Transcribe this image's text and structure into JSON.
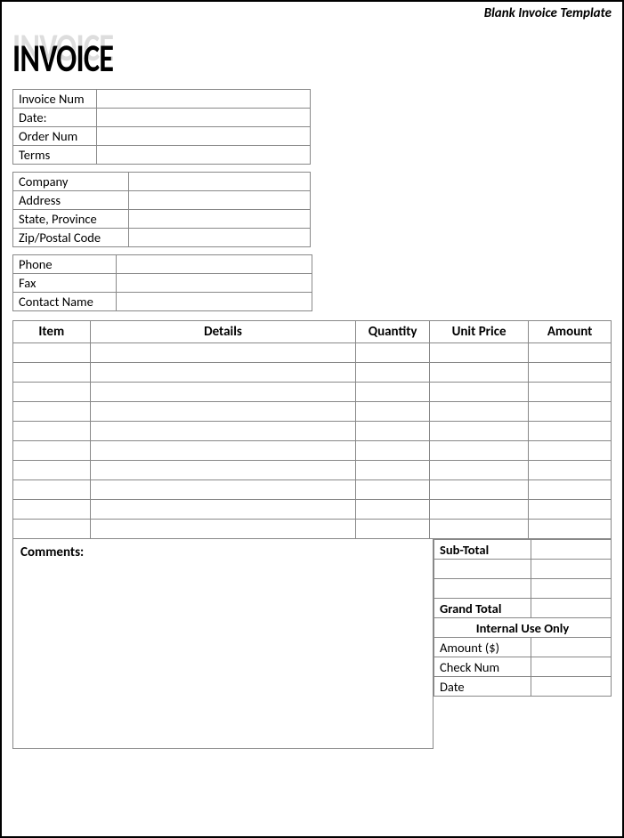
{
  "template_label": "Blank Invoice Template",
  "title": "INVOICE",
  "info1": {
    "invoice_num": "Invoice Num",
    "invoice_num_val": "",
    "date": "Date:",
    "date_val": "",
    "order_num": "Order Num",
    "order_num_val": "",
    "terms": "Terms",
    "terms_val": ""
  },
  "info2": {
    "company": "Company",
    "company_val": "",
    "address": "Address",
    "address_val": "",
    "state": "State, Province",
    "state_val": "",
    "zip": "Zip/Postal Code",
    "zip_val": ""
  },
  "info3": {
    "phone": "Phone",
    "phone_val": "",
    "fax": "Fax",
    "fax_val": "",
    "contact": "Contact Name",
    "contact_val": ""
  },
  "items": {
    "headers": {
      "item": "Item",
      "details": "Details",
      "quantity": "Quantity",
      "unit_price": "Unit Price",
      "amount": "Amount"
    },
    "rows": [
      {
        "item": "",
        "details": "",
        "quantity": "",
        "unit_price": "",
        "amount": ""
      },
      {
        "item": "",
        "details": "",
        "quantity": "",
        "unit_price": "",
        "amount": ""
      },
      {
        "item": "",
        "details": "",
        "quantity": "",
        "unit_price": "",
        "amount": ""
      },
      {
        "item": "",
        "details": "",
        "quantity": "",
        "unit_price": "",
        "amount": ""
      },
      {
        "item": "",
        "details": "",
        "quantity": "",
        "unit_price": "",
        "amount": ""
      },
      {
        "item": "",
        "details": "",
        "quantity": "",
        "unit_price": "",
        "amount": ""
      },
      {
        "item": "",
        "details": "",
        "quantity": "",
        "unit_price": "",
        "amount": ""
      },
      {
        "item": "",
        "details": "",
        "quantity": "",
        "unit_price": "",
        "amount": ""
      },
      {
        "item": "",
        "details": "",
        "quantity": "",
        "unit_price": "",
        "amount": ""
      },
      {
        "item": "",
        "details": "",
        "quantity": "",
        "unit_price": "",
        "amount": ""
      }
    ]
  },
  "comments_label": "Comments:",
  "totals": {
    "subtotal": "Sub-Total",
    "subtotal_val": "",
    "blank1_label": "",
    "blank1_val": "",
    "blank2_label": "",
    "blank2_val": "",
    "grand_total": "Grand Total",
    "grand_total_val": "",
    "internal_header": "Internal Use Only",
    "amount": "Amount ($)",
    "amount_val": "",
    "check_num": "Check Num",
    "check_num_val": "",
    "date": "Date",
    "date_val": ""
  }
}
